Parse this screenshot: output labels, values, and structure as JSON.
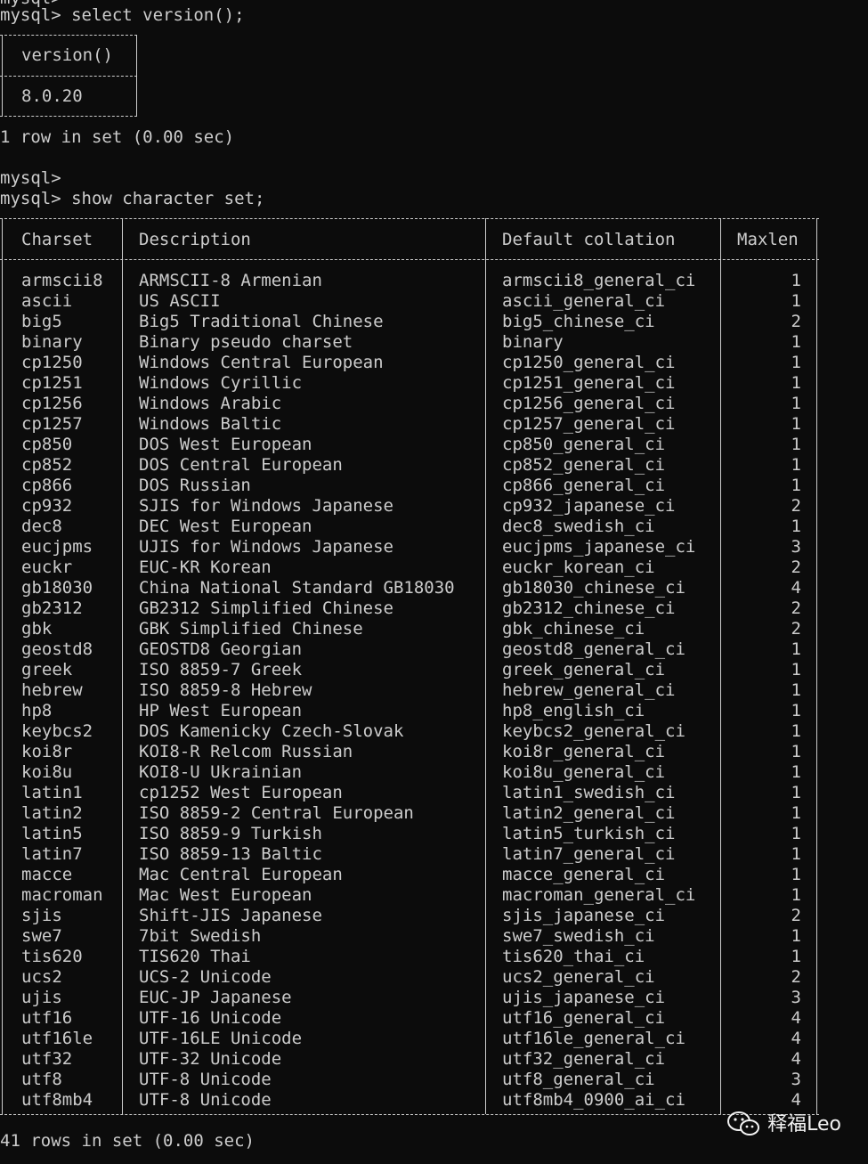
{
  "terminal": {
    "top_cutoff": "mysql>",
    "cmd1": "mysql> select version();",
    "version_header": "version()",
    "version_value": "8.0.20",
    "result1": "1 row in set (0.00 sec)",
    "blank_prompt": "mysql>",
    "cmd2": "mysql> show character set;",
    "headers": [
      "Charset",
      "Description",
      "Default collation",
      "Maxlen"
    ],
    "rows": [
      [
        "armscii8",
        "ARMSCII-8 Armenian",
        "armscii8_general_ci",
        "1"
      ],
      [
        "ascii",
        "US ASCII",
        "ascii_general_ci",
        "1"
      ],
      [
        "big5",
        "Big5 Traditional Chinese",
        "big5_chinese_ci",
        "2"
      ],
      [
        "binary",
        "Binary pseudo charset",
        "binary",
        "1"
      ],
      [
        "cp1250",
        "Windows Central European",
        "cp1250_general_ci",
        "1"
      ],
      [
        "cp1251",
        "Windows Cyrillic",
        "cp1251_general_ci",
        "1"
      ],
      [
        "cp1256",
        "Windows Arabic",
        "cp1256_general_ci",
        "1"
      ],
      [
        "cp1257",
        "Windows Baltic",
        "cp1257_general_ci",
        "1"
      ],
      [
        "cp850",
        "DOS West European",
        "cp850_general_ci",
        "1"
      ],
      [
        "cp852",
        "DOS Central European",
        "cp852_general_ci",
        "1"
      ],
      [
        "cp866",
        "DOS Russian",
        "cp866_general_ci",
        "1"
      ],
      [
        "cp932",
        "SJIS for Windows Japanese",
        "cp932_japanese_ci",
        "2"
      ],
      [
        "dec8",
        "DEC West European",
        "dec8_swedish_ci",
        "1"
      ],
      [
        "eucjpms",
        "UJIS for Windows Japanese",
        "eucjpms_japanese_ci",
        "3"
      ],
      [
        "euckr",
        "EUC-KR Korean",
        "euckr_korean_ci",
        "2"
      ],
      [
        "gb18030",
        "China National Standard GB18030",
        "gb18030_chinese_ci",
        "4"
      ],
      [
        "gb2312",
        "GB2312 Simplified Chinese",
        "gb2312_chinese_ci",
        "2"
      ],
      [
        "gbk",
        "GBK Simplified Chinese",
        "gbk_chinese_ci",
        "2"
      ],
      [
        "geostd8",
        "GEOSTD8 Georgian",
        "geostd8_general_ci",
        "1"
      ],
      [
        "greek",
        "ISO 8859-7 Greek",
        "greek_general_ci",
        "1"
      ],
      [
        "hebrew",
        "ISO 8859-8 Hebrew",
        "hebrew_general_ci",
        "1"
      ],
      [
        "hp8",
        "HP West European",
        "hp8_english_ci",
        "1"
      ],
      [
        "keybcs2",
        "DOS Kamenicky Czech-Slovak",
        "keybcs2_general_ci",
        "1"
      ],
      [
        "koi8r",
        "KOI8-R Relcom Russian",
        "koi8r_general_ci",
        "1"
      ],
      [
        "koi8u",
        "KOI8-U Ukrainian",
        "koi8u_general_ci",
        "1"
      ],
      [
        "latin1",
        "cp1252 West European",
        "latin1_swedish_ci",
        "1"
      ],
      [
        "latin2",
        "ISO 8859-2 Central European",
        "latin2_general_ci",
        "1"
      ],
      [
        "latin5",
        "ISO 8859-9 Turkish",
        "latin5_turkish_ci",
        "1"
      ],
      [
        "latin7",
        "ISO 8859-13 Baltic",
        "latin7_general_ci",
        "1"
      ],
      [
        "macce",
        "Mac Central European",
        "macce_general_ci",
        "1"
      ],
      [
        "macroman",
        "Mac West European",
        "macroman_general_ci",
        "1"
      ],
      [
        "sjis",
        "Shift-JIS Japanese",
        "sjis_japanese_ci",
        "2"
      ],
      [
        "swe7",
        "7bit Swedish",
        "swe7_swedish_ci",
        "1"
      ],
      [
        "tis620",
        "TIS620 Thai",
        "tis620_thai_ci",
        "1"
      ],
      [
        "ucs2",
        "UCS-2 Unicode",
        "ucs2_general_ci",
        "2"
      ],
      [
        "ujis",
        "EUC-JP Japanese",
        "ujis_japanese_ci",
        "3"
      ],
      [
        "utf16",
        "UTF-16 Unicode",
        "utf16_general_ci",
        "4"
      ],
      [
        "utf16le",
        "UTF-16LE Unicode",
        "utf16le_general_ci",
        "4"
      ],
      [
        "utf32",
        "UTF-32 Unicode",
        "utf32_general_ci",
        "4"
      ],
      [
        "utf8",
        "UTF-8 Unicode",
        "utf8_general_ci",
        "3"
      ],
      [
        "utf8mb4",
        "UTF-8 Unicode",
        "utf8mb4_0900_ai_ci",
        "4"
      ]
    ],
    "result2": "41 rows in set (0.00 sec)"
  },
  "watermark": {
    "text": "释福Leo",
    "icon": "wechat-icon"
  },
  "colors": {
    "background": "#0c0c0c",
    "text": "#cccccc"
  }
}
